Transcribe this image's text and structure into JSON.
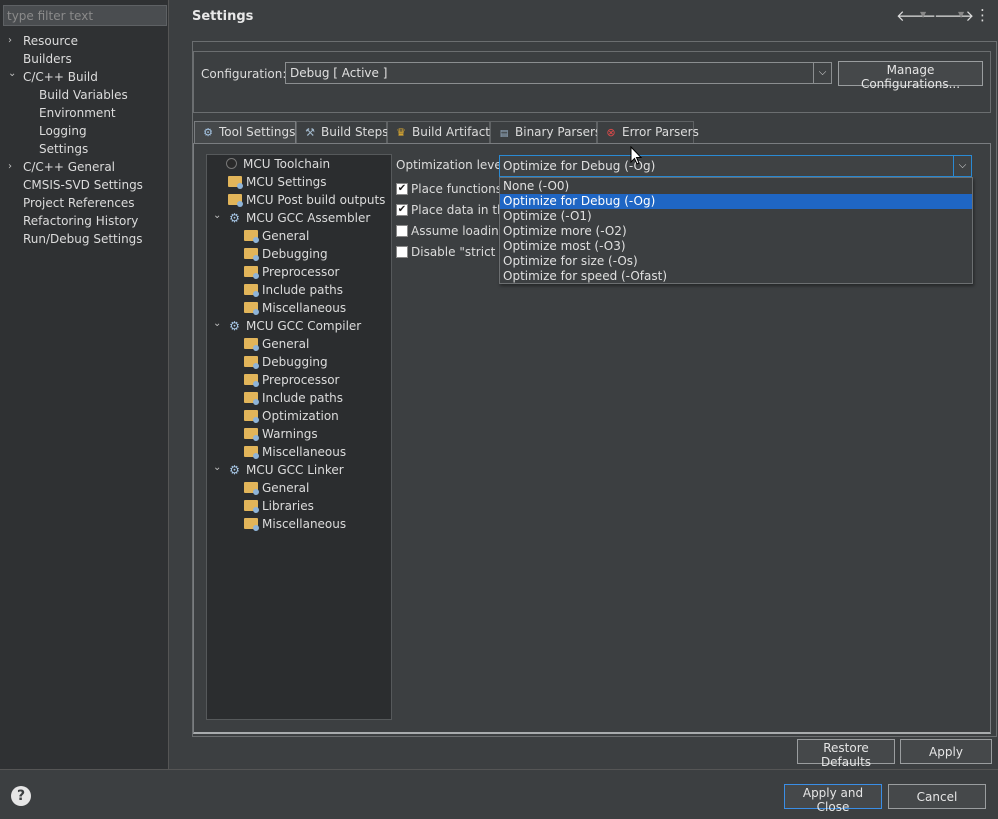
{
  "sidebar": {
    "filter_placeholder": "type filter text",
    "items": [
      {
        "label": "Resource",
        "arrow": "›"
      },
      {
        "label": "Builders"
      },
      {
        "label": "C/C++ Build",
        "arrow": "⌄"
      },
      {
        "label": "Build Variables"
      },
      {
        "label": "Environment"
      },
      {
        "label": "Logging"
      },
      {
        "label": "Settings"
      },
      {
        "label": "C/C++ General",
        "arrow": "›"
      },
      {
        "label": "CMSIS-SVD Settings"
      },
      {
        "label": "Project References"
      },
      {
        "label": "Refactoring History"
      },
      {
        "label": "Run/Debug Settings"
      }
    ]
  },
  "header": {
    "title": "Settings",
    "back_icon": "🡐",
    "forward_icon": "🡒",
    "menu_icon": "⋮"
  },
  "config": {
    "label": "Configuration:",
    "value": "Debug  [ Active ]",
    "manage_button": "Manage Configurations..."
  },
  "tabs": [
    {
      "label": "Tool Settings",
      "icon": "gear-icon"
    },
    {
      "label": "Build Steps",
      "icon": "hammer-icon"
    },
    {
      "label": "Build Artifact",
      "icon": "trophy-icon"
    },
    {
      "label": "Binary Parsers",
      "icon": "binary-icon"
    },
    {
      "label": "Error Parsers",
      "icon": "error-icon"
    }
  ],
  "tree": {
    "toolchain": "MCU Toolchain",
    "settings": "MCU Settings",
    "post_build": "MCU Post build outputs",
    "assembler": {
      "label": "MCU GCC Assembler",
      "children": [
        "General",
        "Debugging",
        "Preprocessor",
        "Include paths",
        "Miscellaneous"
      ]
    },
    "compiler": {
      "label": "MCU GCC Compiler",
      "children": [
        "General",
        "Debugging",
        "Preprocessor",
        "Include paths",
        "Optimization",
        "Warnings",
        "Miscellaneous"
      ]
    },
    "linker": {
      "label": "MCU GCC Linker",
      "children": [
        "General",
        "Libraries",
        "Miscellaneous"
      ]
    }
  },
  "options": {
    "optimization_label": "Optimization level",
    "optimization_value": "Optimize for Debug (-Og)",
    "checkboxes": [
      {
        "label": "Place functions i",
        "checked": true
      },
      {
        "label": "Place data in the",
        "checked": true
      },
      {
        "label": "Assume loading",
        "checked": false
      },
      {
        "label": "Disable \"strict ali",
        "checked": false
      }
    ],
    "dropdown_options": [
      "None (-O0)",
      "Optimize for Debug (-Og)",
      "Optimize (-O1)",
      "Optimize more (-O2)",
      "Optimize most (-O3)",
      "Optimize for size (-Os)",
      "Optimize for speed (-Ofast)"
    ],
    "dropdown_selected": "Optimize for Debug (-Og)"
  },
  "buttons": {
    "restore_defaults": "Restore Defaults",
    "apply": "Apply",
    "apply_close": "Apply and Close",
    "cancel": "Cancel"
  },
  "colors": {
    "selection": "#1f66c4",
    "focus_border": "#2a8ad4",
    "background": "#3c3f41"
  }
}
